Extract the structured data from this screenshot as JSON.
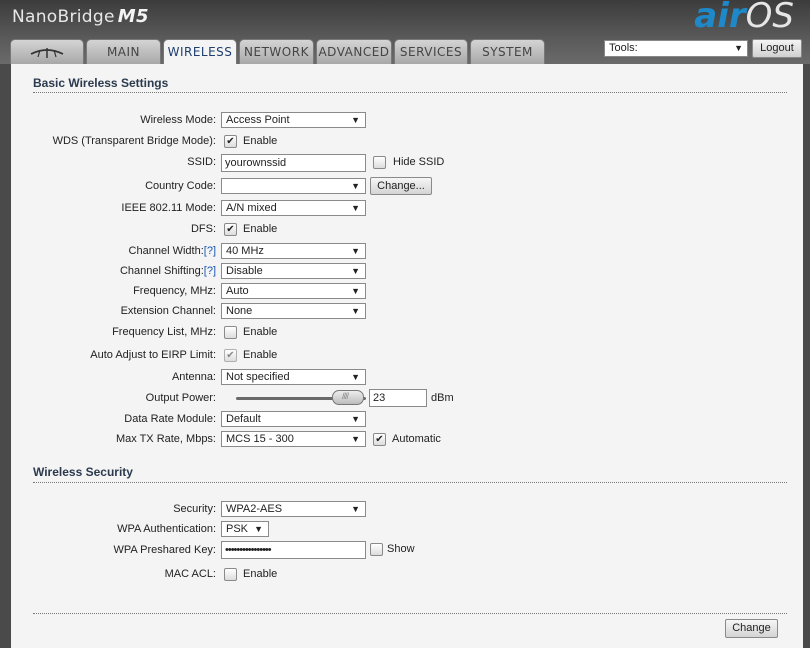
{
  "brand": {
    "name": "NanoBridge",
    "model": "M5",
    "os_air": "air",
    "os_name": "OS"
  },
  "tabs": [
    "MAIN",
    "WIRELESS",
    "NETWORK",
    "ADVANCED",
    "SERVICES",
    "SYSTEM"
  ],
  "active_tab": "WIRELESS",
  "tools": {
    "label": "Tools:"
  },
  "logout_label": "Logout",
  "basic": {
    "title": "Basic Wireless Settings",
    "wireless_mode": {
      "label": "Wireless Mode:",
      "value": "Access Point"
    },
    "wds": {
      "label": "WDS (Transparent Bridge Mode):",
      "check_label": "Enable",
      "checked": true
    },
    "ssid": {
      "label": "SSID:",
      "value": "yourownssid",
      "hide_label": "Hide SSID"
    },
    "country": {
      "label": "Country Code:",
      "value": "",
      "button": "Change..."
    },
    "ieee": {
      "label": "IEEE 802.11 Mode:",
      "value": "A/N mixed"
    },
    "dfs": {
      "label": "DFS:",
      "check_label": "Enable",
      "checked": true
    },
    "channel_width": {
      "label": "Channel Width:",
      "help": "[?]",
      "value": "40 MHz"
    },
    "channel_shifting": {
      "label": "Channel Shifting:",
      "help": "[?]",
      "value": "Disable"
    },
    "frequency": {
      "label": "Frequency, MHz:",
      "value": "Auto"
    },
    "extension_channel": {
      "label": "Extension Channel:",
      "value": "None"
    },
    "frequency_list": {
      "label": "Frequency List, MHz:",
      "check_label": "Enable",
      "checked": false
    },
    "auto_adjust": {
      "label": "Auto Adjust to EIRP Limit:",
      "check_label": "Enable",
      "checked": true
    },
    "antenna": {
      "label": "Antenna:",
      "value": "Not specified"
    },
    "output_power": {
      "label": "Output Power:",
      "value": "23",
      "unit": "dBm",
      "level_fraction": 0.95
    },
    "data_rate": {
      "label": "Data Rate Module:",
      "value": "Default"
    },
    "max_tx": {
      "label": "Max TX Rate, Mbps:",
      "value": "MCS 15 - 300",
      "check_label": "Automatic",
      "checked": true
    }
  },
  "security": {
    "title": "Wireless Security",
    "security": {
      "label": "Security:",
      "value": "WPA2-AES"
    },
    "wpa_auth": {
      "label": "WPA Authentication:",
      "value": "PSK"
    },
    "psk": {
      "label": "WPA Preshared Key:",
      "value": "••••••••••••••••",
      "show_label": "Show"
    },
    "mac_acl": {
      "label": "MAC ACL:",
      "check_label": "Enable",
      "checked": false
    }
  },
  "change_label": "Change"
}
